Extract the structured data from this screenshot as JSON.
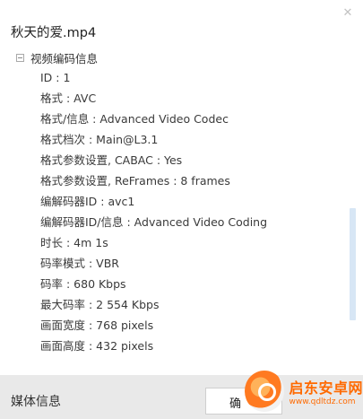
{
  "window": {
    "title": "秋天的爱.mp4",
    "close_symbol": "✕"
  },
  "section": {
    "label": "视频编码信息",
    "rows": [
      "ID : 1",
      "格式 : AVC",
      "格式/信息 : Advanced Video Codec",
      "格式档次 : Main@L3.1",
      "格式参数设置, CABAC : Yes",
      "格式参数设置, ReFrames : 8 frames",
      "编解码器ID : avc1",
      "编解码器ID/信息 : Advanced Video Coding",
      "时长 : 4m 1s",
      "码率模式 : VBR",
      "码率 : 680 Kbps",
      "最大码率 : 2 554 Kbps",
      "画面宽度 : 768 pixels",
      "画面高度 : 432 pixels"
    ]
  },
  "footer": {
    "title": "媒体信息",
    "ok_label": "确"
  },
  "watermark": {
    "text": "启东安卓网",
    "url": "www.qdltdz.com"
  },
  "colors": {
    "scrollbar": "#d7e6f5",
    "footer_bg": "#e9e9e9",
    "watermark": "#ff6a00"
  }
}
